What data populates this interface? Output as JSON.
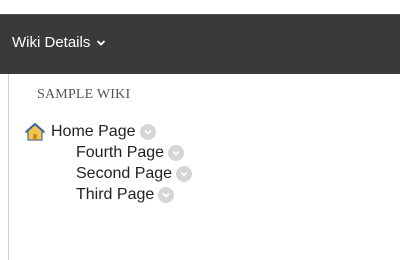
{
  "header": {
    "title": "Wiki Details"
  },
  "wiki": {
    "name": "SAMPLE WIKI",
    "pages": [
      {
        "label": "Home Page",
        "icon": "home-icon"
      },
      {
        "label": "Fourth Page"
      },
      {
        "label": "Second Page"
      },
      {
        "label": "Third Page"
      }
    ]
  },
  "colors": {
    "header_bg": "#3a3a3a",
    "header_text": "#ffffff",
    "menu_button": "#d6d6d6"
  }
}
